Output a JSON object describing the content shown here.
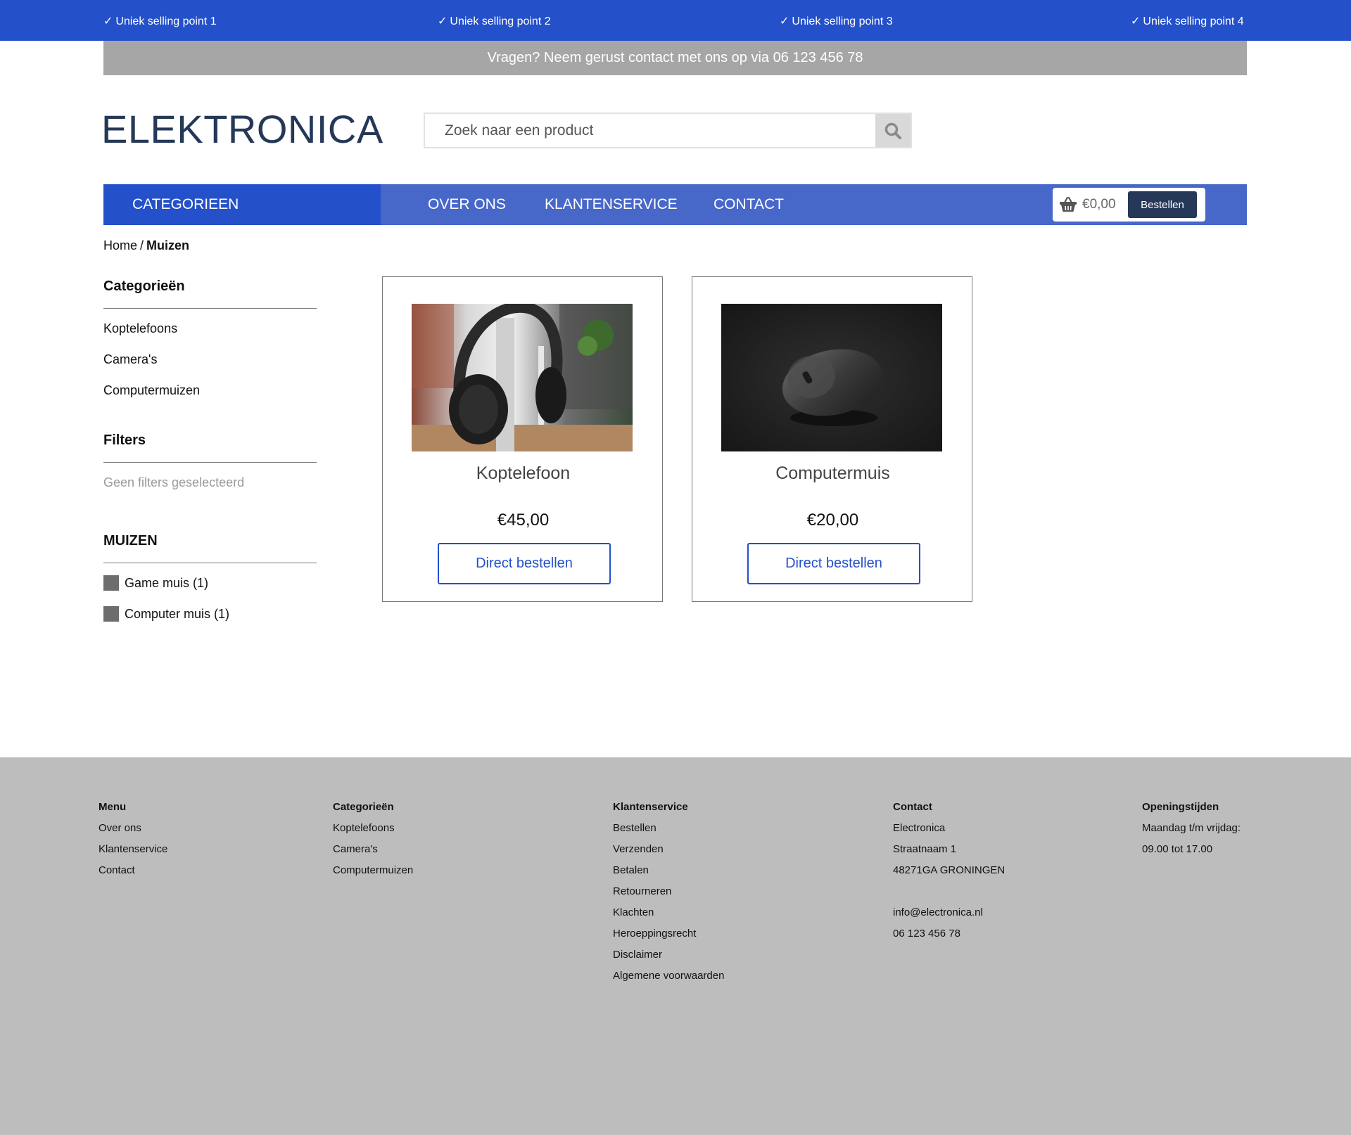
{
  "usp_bar": {
    "tick": "✓",
    "items": [
      "Uniek selling point 1",
      "Uniek selling point 2",
      "Uniek selling point 3",
      "Uniek selling point 4"
    ]
  },
  "contact_bar": {
    "text": "Vragen? Neem gerust contact met ons op via 06 123 456 78"
  },
  "header": {
    "logo": "ELEKTRONICA",
    "search": {
      "placeholder": "Zoek naar een product",
      "value": "",
      "icon": "search-icon"
    }
  },
  "nav": {
    "categories_label": "CATEGORIEEN",
    "links": [
      "OVER ONS",
      "KLANTENSERVICE",
      "CONTACT"
    ],
    "cart": {
      "icon": "basket-icon",
      "amount": "€0,00",
      "button_label": "Bestellen"
    }
  },
  "breadcrumb": {
    "home": "Home",
    "separator": "/",
    "current": "Muizen"
  },
  "sidebar": {
    "categories_title": "Categorieën",
    "categories": [
      "Koptelefoons",
      "Camera's",
      "Computermuizen"
    ],
    "filters_title": "Filters",
    "filters_empty": "Geen filters geselecteerd",
    "group_title": "MUIZEN",
    "group_options": [
      "Game muis (1)",
      "Computer muis (1)"
    ]
  },
  "products": [
    {
      "name": "Koptelefoon",
      "price": "€45,00",
      "button_label": "Direct bestellen",
      "image": "headphones-photo"
    },
    {
      "name": "Computermuis",
      "price": "€20,00",
      "button_label": "Direct bestellen",
      "image": "computer-mouse-photo"
    }
  ],
  "footer": {
    "menu": {
      "title": "Menu",
      "items": [
        "Over ons",
        "Klantenservice",
        "Contact"
      ]
    },
    "categories": {
      "title": "Categorieën",
      "items": [
        "Koptelefoons",
        "Camera's",
        "Computermuizen"
      ]
    },
    "service": {
      "title": "Klantenservice",
      "items": [
        "Bestellen",
        "Verzenden",
        "Betalen",
        "Retourneren",
        "Klachten",
        "Heroeppingsrecht",
        "Disclaimer",
        "Algemene voorwaarden"
      ]
    },
    "contact": {
      "title": "Contact",
      "company": "Electronica",
      "street": "Straatnaam 1",
      "city": "48271GA GRONINGEN",
      "email": "info@electronica.nl",
      "phone": "06 123 456 78"
    },
    "hours": {
      "title": "Openingstijden",
      "days": "Maandag t/m vrijdag:",
      "time": "09.00 tot 17.00"
    }
  },
  "colors": {
    "primary_blue": "#2450c9",
    "nav_blue": "#4767c9",
    "navy": "#263858",
    "gray_bar": "#a6a6a6",
    "footer_gray": "#bdbdbd"
  }
}
